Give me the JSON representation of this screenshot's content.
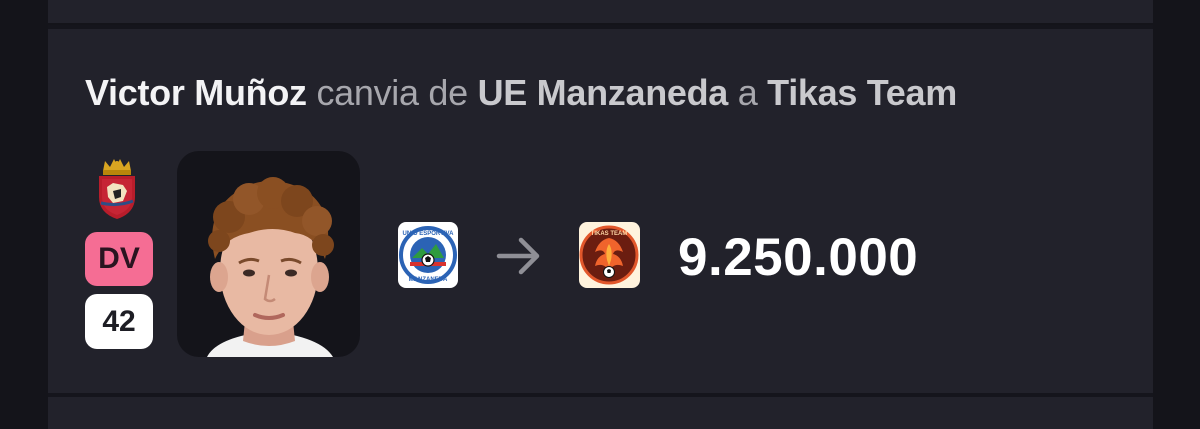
{
  "transfer": {
    "player_name": "Victor Muñoz",
    "verb": "canvia de",
    "from_team": "UE Manzaneda",
    "connector": "a",
    "to_team": "Tikas Team",
    "position": "DV",
    "number": "42",
    "value": "9.250.000"
  },
  "icons": {
    "club_crest": "osasuna-crest-icon",
    "from_logo": "ue-manzaneda-logo-icon",
    "to_logo": "tikas-team-logo-icon",
    "arrow": "arrow-right-icon"
  },
  "logo_text": {
    "from_logo_top": "UNIÓ ESPORTIVA",
    "from_logo_bottom": "MANZANEDA",
    "to_logo_top": "TIKAS TEAM"
  },
  "colors": {
    "background": "#15151c",
    "card": "#22222b",
    "position_badge": "#f56d94",
    "number_badge": "#ffffff",
    "headline_strong": "#f3f3f5",
    "headline_muted": "#a7a7ad"
  }
}
